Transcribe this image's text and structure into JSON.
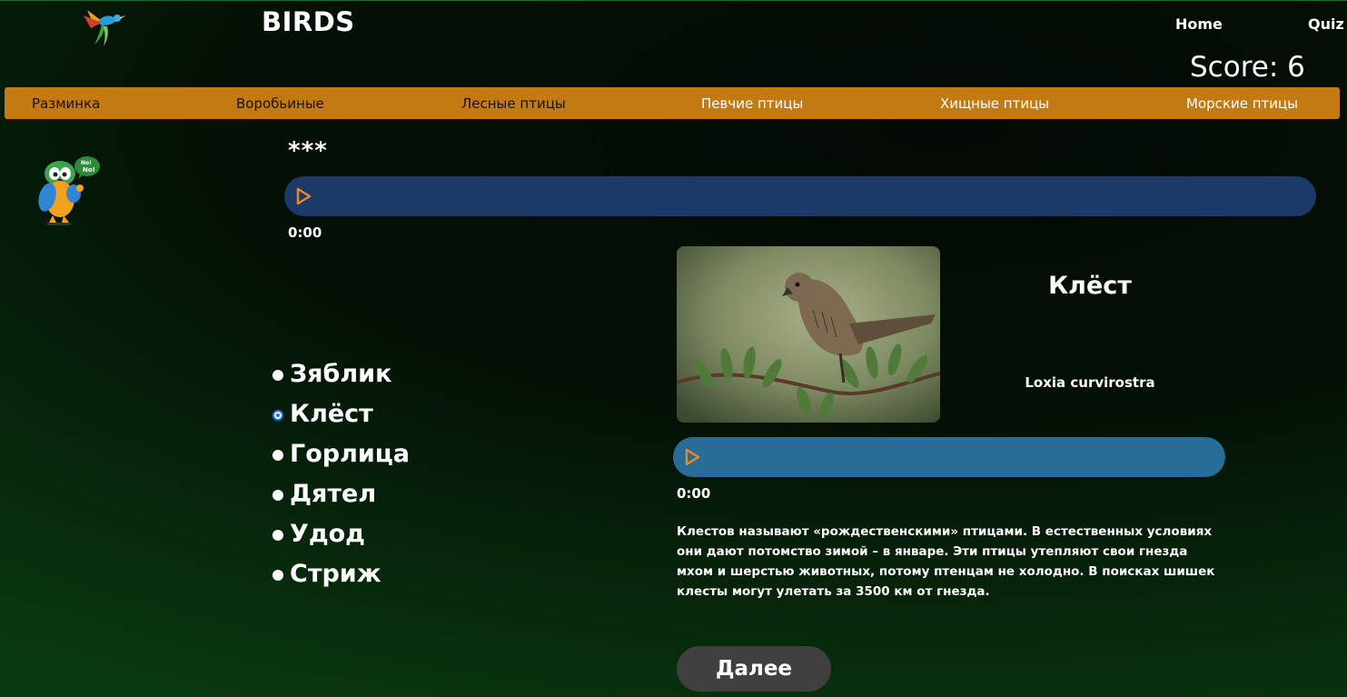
{
  "header": {
    "title": "BIRDS",
    "nav": {
      "home": "Home",
      "quiz": "Quiz"
    },
    "score_text": "Score: 6"
  },
  "categories": [
    {
      "label": "Разминка",
      "active": true
    },
    {
      "label": "Воробьиные",
      "active": true
    },
    {
      "label": "Лесные птицы",
      "active": true
    },
    {
      "label": "Певчие птицы",
      "active": false
    },
    {
      "label": "Хищные птицы",
      "active": false
    },
    {
      "label": "Морские птицы",
      "active": false
    }
  ],
  "question": {
    "hidden_name": "***",
    "player_time": "0:00"
  },
  "answers": [
    {
      "label": "Зяблик",
      "selected": false
    },
    {
      "label": "Клёст",
      "selected": true
    },
    {
      "label": "Горлица",
      "selected": false
    },
    {
      "label": "Дятел",
      "selected": false
    },
    {
      "label": "Удод",
      "selected": false
    },
    {
      "label": "Стриж",
      "selected": false
    }
  ],
  "bird_card": {
    "name": "Клёст",
    "latin": "Loxia curvirostra",
    "player_time": "0:00",
    "description": "Клестов называют «рождественскими» птицами. В естественных условиях они дают потомство зимой – в январе. Эти птицы утепляют свои гнезда мхом и шерстью животных, потому птенцам не холодно. В поисках шишек клесты могут улетать за 3500 км от гнезда."
  },
  "next_button": "Далее",
  "colors": {
    "category_bar": "#c47a12",
    "player_main": "#1b3a68",
    "player_detail": "#286c98",
    "play_icon": "#e8892a",
    "next_button": "#404040"
  },
  "icons": {
    "logo": "hummingbird-logo-icon",
    "mascot": "parrot-mascot",
    "play": "play-icon"
  }
}
